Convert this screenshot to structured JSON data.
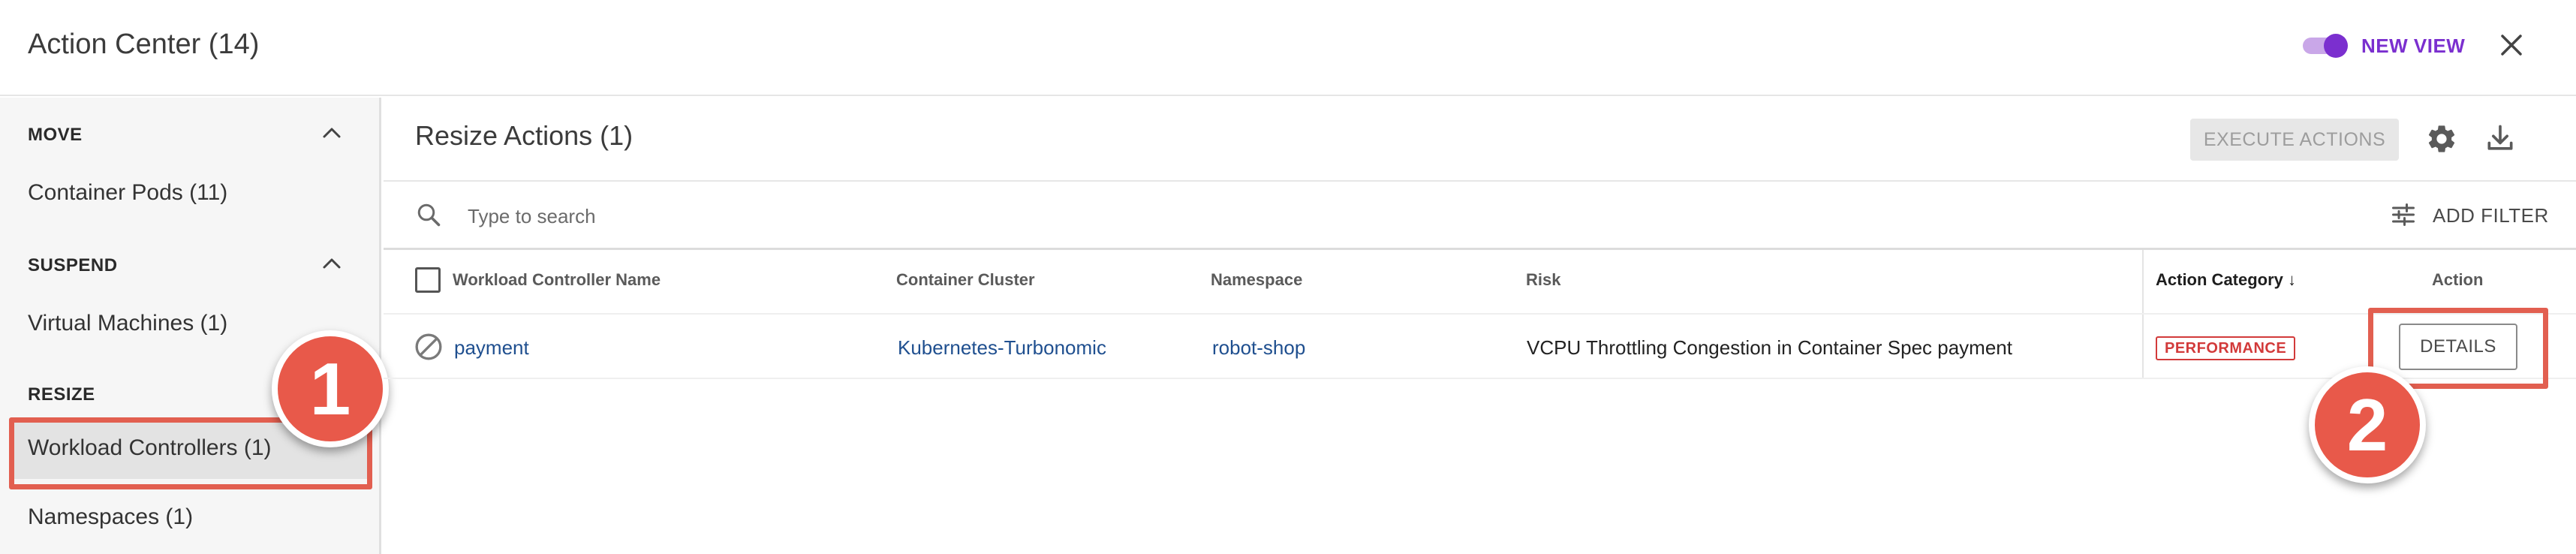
{
  "header": {
    "title": "Action Center (14)",
    "new_view_label": "NEW VIEW",
    "toggle_on": true,
    "accent_color": "#7b2fcf"
  },
  "sidebar": {
    "sections": [
      {
        "heading": "MOVE",
        "items": [
          "Container Pods (11)"
        ]
      },
      {
        "heading": "SUSPEND",
        "items": [
          "Virtual Machines (1)"
        ]
      },
      {
        "heading": "RESIZE",
        "items": [
          "Workload Controllers (1)",
          "Namespaces (1)"
        ]
      }
    ],
    "selected_item": "Workload Controllers (1)"
  },
  "main": {
    "title": "Resize Actions (1)",
    "execute_label": "EXECUTE ACTIONS",
    "search_placeholder": "Type to search",
    "add_filter_label": "ADD FILTER",
    "columns": [
      "Workload Controller Name",
      "Container Cluster",
      "Namespace",
      "Risk",
      "Action Category",
      "Action"
    ],
    "sort_indicator": "↓",
    "rows": [
      {
        "name": "payment",
        "cluster": "Kubernetes-Turbonomic",
        "namespace": "robot-shop",
        "risk": "VCPU Throttling Congestion in Container Spec payment",
        "category": "PERFORMANCE",
        "action_label": "DETAILS"
      }
    ]
  },
  "annotations": {
    "marker1": "1",
    "marker2": "2",
    "highlight_color": "#e25f50"
  },
  "icons": [
    "close-icon",
    "chevron-up-icon",
    "gear-icon",
    "download-icon",
    "search-icon",
    "filter-icon",
    "ban-icon"
  ]
}
